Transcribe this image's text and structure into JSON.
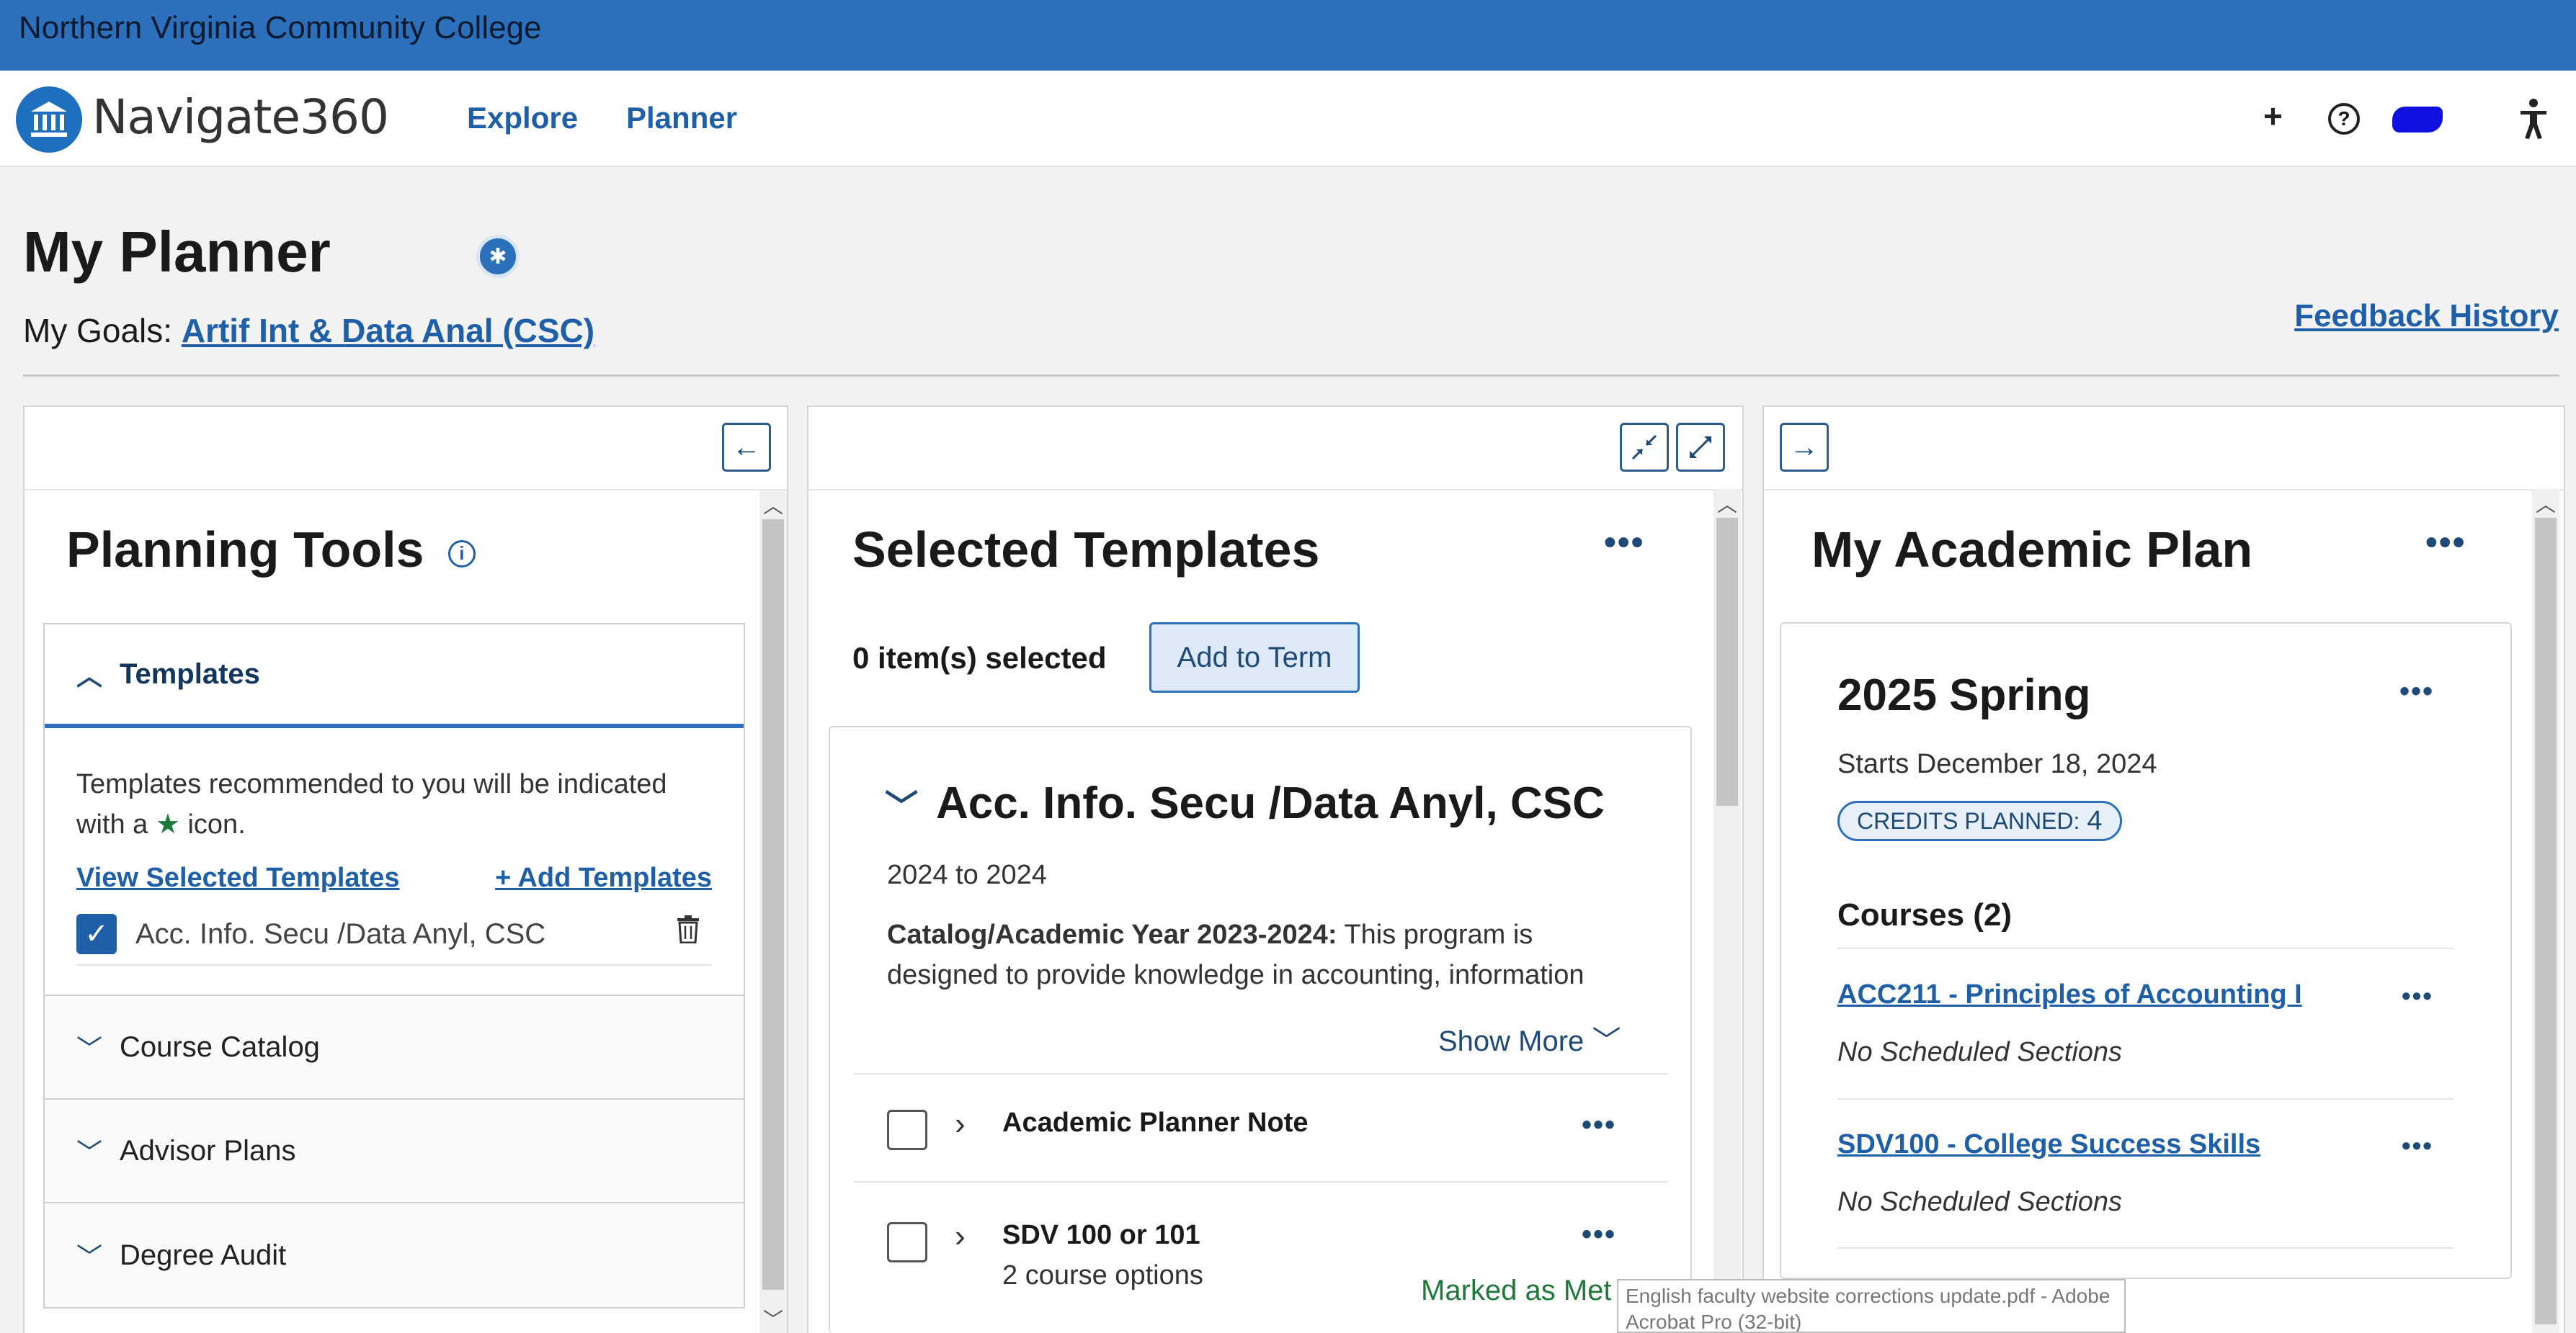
{
  "college": {
    "name": "Northern Virginia Community College"
  },
  "header": {
    "brand": "Navigate360",
    "nav": [
      {
        "label": "Explore"
      },
      {
        "label": "Planner"
      }
    ],
    "icons": [
      "plus-icon",
      "help-icon",
      "avatar",
      "accessibility-icon"
    ],
    "plus": "+",
    "help": "?"
  },
  "page": {
    "title": "My Planner",
    "goals_label": "My Goals:",
    "goal": "Artif Int & Data Anal (CSC)",
    "feedback": "Feedback History"
  },
  "planning_tools": {
    "heading": "Planning Tools",
    "info_icon": "i",
    "templates": {
      "label": "Templates",
      "desc_before": "Templates recommended to you will be indicated with a",
      "desc_after": "icon.",
      "view_link": "View Selected Templates",
      "add_link": "+ Add Templates",
      "item": "Acc. Info. Secu /Data Anyl, CSC"
    },
    "sections": [
      {
        "label": "Course Catalog"
      },
      {
        "label": "Advisor Plans"
      },
      {
        "label": "Degree Audit"
      }
    ]
  },
  "selected_templates": {
    "heading": "Selected Templates",
    "selected_count": "0 item(s) selected",
    "add_to_term": "Add to Term",
    "program": {
      "title": "Acc. Info. Secu /Data Anyl, CSC",
      "years": "2024 to 2024",
      "catalog_label": "Catalog/Academic Year 2023-2024:",
      "catalog_text": "This program is designed to provide knowledge in accounting, information",
      "show_more": "Show More"
    },
    "rows": [
      {
        "title": "Academic Planner Note",
        "subtitle": ""
      },
      {
        "title": "SDV 100 or 101",
        "subtitle": "2 course options"
      }
    ],
    "marked_as_met": "Marked as Met"
  },
  "academic_plan": {
    "heading": "My Academic Plan",
    "term": {
      "name": "2025 Spring",
      "starts": "Starts December 18, 2024",
      "credits_label": "CREDITS PLANNED:",
      "credits_value": "4",
      "courses_heading": "Courses (2)",
      "courses": [
        {
          "name": "ACC211 - Principles of Accounting I",
          "status": "No Scheduled Sections"
        },
        {
          "name": "SDV100 - College Success Skills",
          "status": "No Scheduled Sections"
        }
      ]
    }
  },
  "tooltip": {
    "text": "English faculty website corrections update.pdf - Adobe Acrobat Pro (32-bit)"
  },
  "colors": {
    "brand_bar": "#2c6fbb",
    "link": "#1f5fa8",
    "accent_green": "#1e7a3a"
  }
}
